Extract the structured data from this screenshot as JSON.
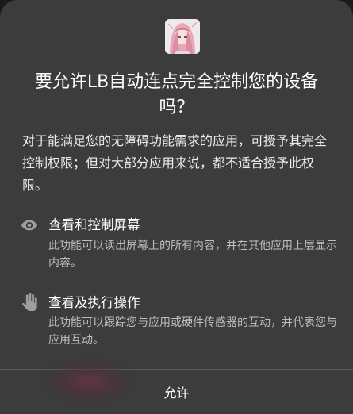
{
  "dialog": {
    "title": "要允许LB自动连点完全控制您的设备吗？",
    "description": "对于能满足您的无障碍功能需求的应用，可授予其完全控制权限；但对大部分应用来说，都不适合授予此权限。",
    "app_icon": "app-avatar-icon"
  },
  "permissions": [
    {
      "icon": "eye-icon",
      "title": "查看和控制屏幕",
      "description": "此功能可以读出屏幕上的所有内容，并在其他应用上层显示内容。"
    },
    {
      "icon": "hand-icon",
      "title": "查看及执行操作",
      "description": "此功能可以跟踪您与应用或硬件传感器的互动，并代表您与应用互动。"
    }
  ],
  "actions": {
    "allow_label": "允许"
  },
  "colors": {
    "dialog_bg": "#3c3c3c",
    "text_primary": "#ffffff",
    "text_secondary": "#bdbdbd",
    "icon_gray": "#9e9e9e"
  }
}
